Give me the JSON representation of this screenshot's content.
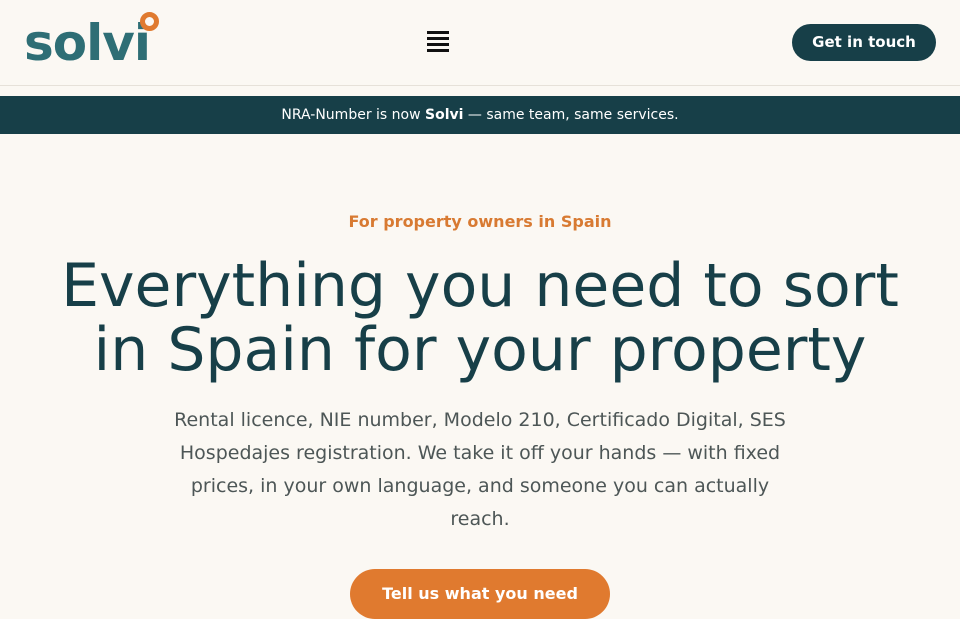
{
  "header": {
    "logo_text": "solvi",
    "menu_icon": "hamburger-menu-icon",
    "cta_label": "Get in touch"
  },
  "banner": {
    "prefix": "NRA-Number is now ",
    "brand": "Solvi",
    "suffix": " — same team, same services."
  },
  "hero": {
    "eyebrow": "For property owners in Spain",
    "headline": "Everything you need to sort in Spain for your property",
    "subtext": "Rental licence, NIE number, Modelo 210, Certificado Digital, SES Hospedajes registration. We take it off your hands — with fixed prices, in your own language, and someone you can actually reach.",
    "cta_label": "Tell us what you need"
  },
  "colors": {
    "background": "#fbf8f3",
    "brand_dark": "#173f48",
    "logo_teal": "#2e6e75",
    "accent_orange": "#e07a2f"
  }
}
